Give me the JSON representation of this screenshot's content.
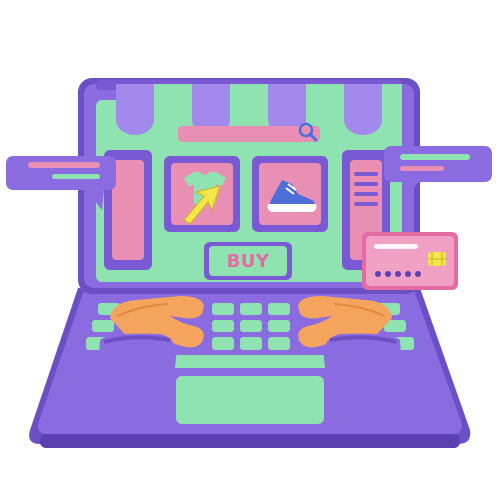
{
  "store": {
    "buy_button_label": "BUY"
  },
  "icons": {
    "product_shirt": "t-shirt-icon",
    "product_shoe": "sneaker-icon",
    "cursor": "arrow-cursor-icon",
    "payment": "credit-card-icon",
    "search": "search-icon"
  },
  "colors": {
    "purple": "#8b6be0",
    "purple_dark": "#6b4fc4",
    "mint": "#8fe3b1",
    "pink": "#e98fb4",
    "hot_pink": "#e46ba4",
    "yellow": "#f3e64a",
    "blue": "#4f6fd8"
  }
}
